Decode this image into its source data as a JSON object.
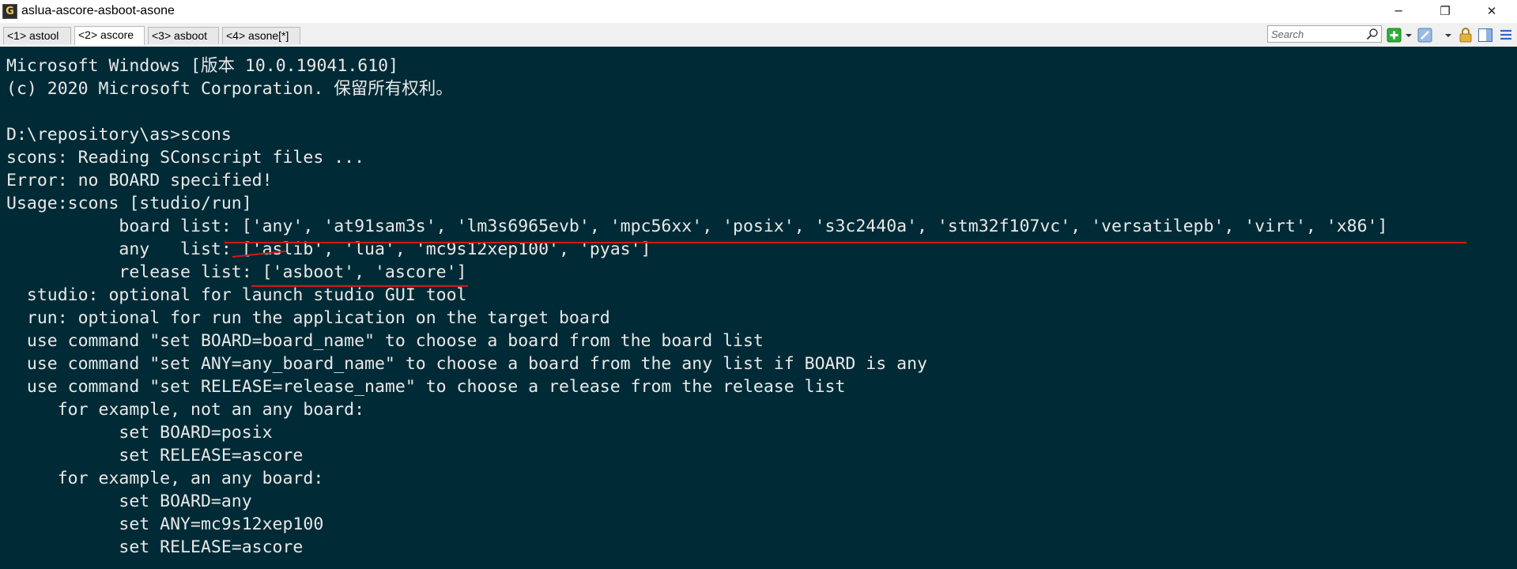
{
  "window": {
    "title": "aslua-ascore-asboot-asone",
    "app_icon_glyph": "G",
    "minimize_glyph": "─",
    "maximize_glyph": "❐",
    "close_glyph": "✕"
  },
  "tabs": [
    {
      "label": "<1> astool",
      "active": false
    },
    {
      "label": "<2> ascore",
      "active": true
    },
    {
      "label": "<3> asboot",
      "active": false
    },
    {
      "label": "<4> asone[*]",
      "active": false
    }
  ],
  "toolbar": {
    "search_placeholder": "Search",
    "search_value": "",
    "icons": [
      "search-icon",
      "new-console-icon",
      "dropdown-arrow-icon",
      "edit-settings-icon",
      "dropdown-arrow-icon",
      "lock-icon",
      "split-pane-icon",
      "hamburger-menu-icon"
    ]
  },
  "console": {
    "colors": {
      "background": "#002b36",
      "text": "#e9e9e9",
      "annotation": "#d11a1a"
    },
    "lines": [
      "Microsoft Windows [版本 10.0.19041.610]",
      "(c) 2020 Microsoft Corporation. 保留所有权利。",
      "",
      "D:\\repository\\as>scons",
      "scons: Reading SConscript files ...",
      "Error: no BOARD specified!",
      "Usage:scons [studio/run]",
      "           board list: ['any', 'at91sam3s', 'lm3s6965evb', 'mpc56xx', 'posix', 's3c2440a', 'stm32f107vc', 'versatilepb', 'virt', 'x86']",
      "           any   list: ['aslib', 'lua', 'mc9s12xep100', 'pyas']",
      "           release list: ['asboot', 'ascore']",
      "  studio: optional for launch studio GUI tool",
      "  run: optional for run the application on the target board",
      "  use command \"set BOARD=board_name\" to choose a board from the board list",
      "  use command \"set ANY=any_board_name\" to choose a board from the any list if BOARD is any",
      "  use command \"set RELEASE=release_name\" to choose a release from the release list",
      "     for example, not an any board:",
      "           set BOARD=posix",
      "           set RELEASE=ascore",
      "     for example, an any board:",
      "           set BOARD=any",
      "           set ANY=mc9s12xep100",
      "           set RELEASE=ascore"
    ]
  }
}
